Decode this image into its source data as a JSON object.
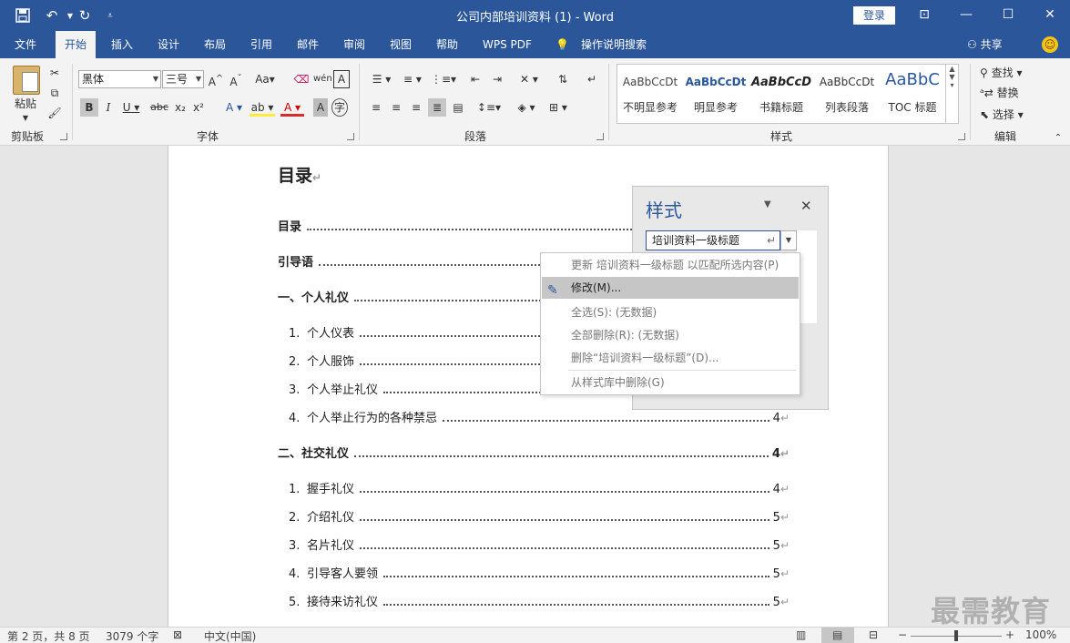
{
  "window": {
    "title": "公司内部培训资料 (1)  -  Word",
    "login_label": "登录"
  },
  "quick_access": {
    "icons": [
      "save-icon",
      "undo-icon",
      "redo-icon",
      "customize-icon"
    ]
  },
  "menu": {
    "tabs": [
      "文件",
      "开始",
      "插入",
      "设计",
      "布局",
      "引用",
      "邮件",
      "审阅",
      "视图",
      "帮助",
      "WPS PDF",
      "操作说明搜索"
    ],
    "active_tab": "开始",
    "share_label": "共享"
  },
  "ribbon": {
    "clipboard": {
      "label": "剪贴板",
      "paste_label": "粘贴"
    },
    "font": {
      "label": "字体",
      "font_name": "黑体",
      "font_size": "三号"
    },
    "paragraph": {
      "label": "段落"
    },
    "styles": {
      "label": "样式",
      "items": [
        {
          "preview": "AaBbCcDt",
          "name": "不明显参考"
        },
        {
          "preview": "AaBbCcDt",
          "name": "明显参考"
        },
        {
          "preview": "AaBbCcD",
          "name": "书籍标题"
        },
        {
          "preview": "AaBbCcDt",
          "name": "列表段落"
        },
        {
          "preview": "AaBbC",
          "name": "TOC 标题"
        }
      ]
    },
    "editing": {
      "label": "编辑",
      "find": "查找",
      "replace": "替换",
      "select": "选择"
    }
  },
  "document": {
    "heading": "目录",
    "toc": [
      {
        "num": "",
        "text": "目录",
        "page": "",
        "level": 1
      },
      {
        "num": "",
        "text": "引导语",
        "page": "",
        "level": 1
      },
      {
        "num": "",
        "text": "一、个人礼仪",
        "page": "",
        "level": 1
      },
      {
        "num": "1.",
        "text": "个人仪表",
        "page": "",
        "level": 2
      },
      {
        "num": "2.",
        "text": "个人服饰",
        "page": "",
        "level": 2
      },
      {
        "num": "3.",
        "text": "个人举止礼仪",
        "page": "",
        "level": 2
      },
      {
        "num": "4.",
        "text": "个人举止行为的各种禁忌",
        "page": "4",
        "level": 2
      },
      {
        "num": "",
        "text": "二、社交礼仪",
        "page": "4",
        "level": 1
      },
      {
        "num": "1.",
        "text": "握手礼仪",
        "page": "4",
        "level": 2
      },
      {
        "num": "2.",
        "text": "介绍礼仪",
        "page": "5",
        "level": 2
      },
      {
        "num": "3.",
        "text": "名片礼仪",
        "page": "5",
        "level": 2
      },
      {
        "num": "4.",
        "text": "引导客人要领",
        "page": "5",
        "level": 2
      },
      {
        "num": "5.",
        "text": "接待来访礼仪",
        "page": "5",
        "level": 2
      }
    ]
  },
  "styles_pane": {
    "title": "样式",
    "selected_style": "培训资料一级标题"
  },
  "context_menu": {
    "items": [
      {
        "label": "更新 培训资料一级标题 以匹配所选内容(P)",
        "state": "disabled"
      },
      {
        "label": "修改(M)...",
        "state": "hover"
      },
      {
        "label": "全选(S): (无数据)",
        "state": "disabled"
      },
      {
        "label": "全部删除(R): (无数据)",
        "state": "disabled"
      },
      {
        "label": "删除“培训资料一级标题”(D)...",
        "state": "disabled"
      },
      {
        "label": "从样式库中删除(G)",
        "state": "disabled"
      }
    ]
  },
  "status_bar": {
    "page": "第 2 页，共 8 页",
    "words": "3079 个字",
    "language": "中文(中国)",
    "zoom": "100%"
  },
  "watermark": "最需教育"
}
